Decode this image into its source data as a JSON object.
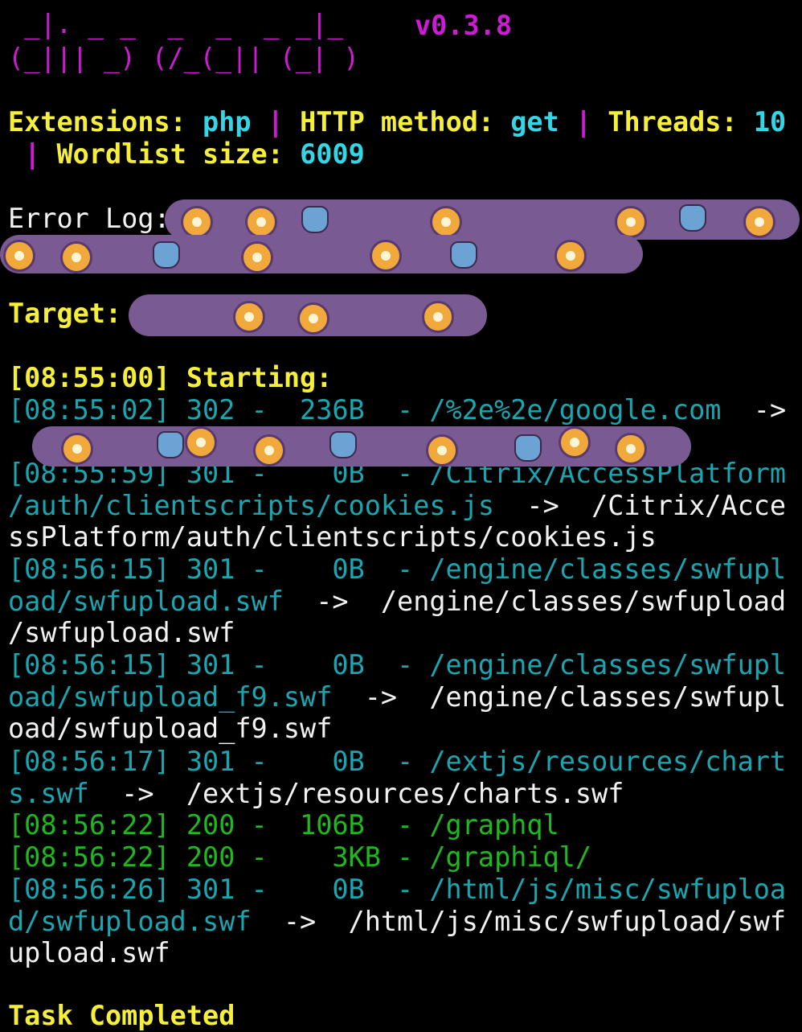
{
  "logo": {
    "line1": " _|. _ _  _  _  _ _|_",
    "line2": "(_||| _) (/_(_|| (_| )",
    "version": "v0.3.8"
  },
  "config": {
    "extensions_label": "Extensions:",
    "extensions_value": "php",
    "sep1": "|",
    "method_label": "HTTP method:",
    "method_value": "get",
    "sep2": "|",
    "threads_label": "Threads:",
    "threads_value": "10",
    "sep3": "|",
    "wordlist_label": "Wordlist size:",
    "wordlist_value": "6009"
  },
  "error_log_label": "Error Log:",
  "target_label": "Target:",
  "start": {
    "time": "[08:55:00]",
    "text": "Starting:"
  },
  "results": [
    {
      "prefix": "[08:55:02] 302 -  236B  - ",
      "path": "/%2e%2e/google.com",
      "arrow": "  ->",
      "redirect": ""
    },
    {
      "prefix": "[08:55:59] 301 -    0B  - ",
      "path": "/Citrix/AccessPlatform/auth/clientscripts/cookies.js",
      "arrow": "  ->  ",
      "redirect": "/Citrix/AccessPlatform/auth/clientscripts/cookies.js"
    },
    {
      "prefix": "[08:56:15] 301 -    0B  - ",
      "path": "/engine/classes/swfupload/swfupload.swf",
      "arrow": "  ->  ",
      "redirect": "/engine/classes/swfupload/swfupload.swf"
    },
    {
      "prefix": "[08:56:15] 301 -    0B  - ",
      "path": "/engine/classes/swfupload/swfupload_f9.swf",
      "arrow": "  ->  ",
      "redirect": "/engine/classes/swfupload/swfupload_f9.swf"
    },
    {
      "prefix": "[08:56:17] 301 -    0B  - ",
      "path": "/extjs/resources/charts.swf",
      "arrow": "  ->  ",
      "redirect": "/extjs/resources/charts.swf"
    },
    {
      "prefix": "[08:56:22] 200 -  106B  - ",
      "path": "/graphql",
      "arrow": "",
      "redirect": ""
    },
    {
      "prefix": "[08:56:22] 200 -    3KB - ",
      "path": "/graphiql/",
      "arrow": "",
      "redirect": ""
    },
    {
      "prefix": "[08:56:26] 301 -    0B  - ",
      "path": "/html/js/misc/swfupload/swfupload.swf",
      "arrow": "  ->  ",
      "redirect": "/html/js/misc/swfupload/swfupload.swf"
    }
  ],
  "footer": "Task Completed",
  "colors": {
    "magenta": "#d11ad8",
    "yellow": "#f5ef3a",
    "cyan": "#33d6e6",
    "teal": "#19a6b0",
    "green": "#1fb81f",
    "redaction": "#7a5a92"
  }
}
